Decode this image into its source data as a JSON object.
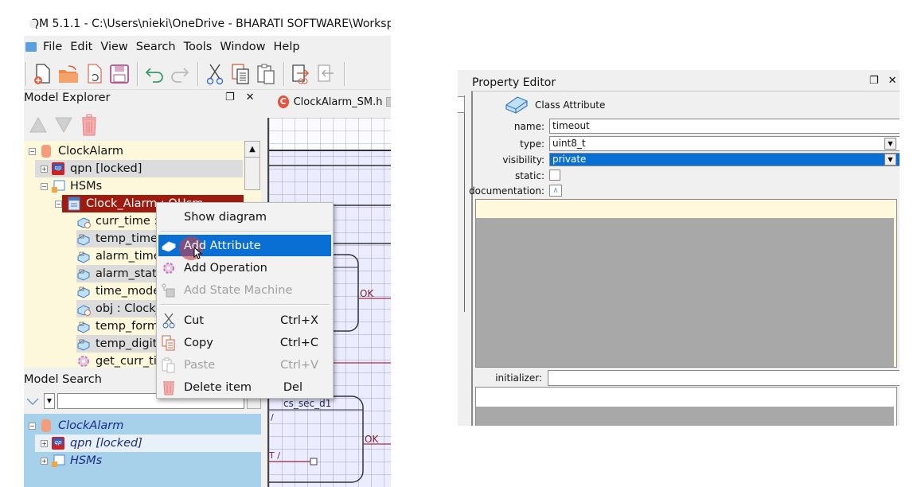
{
  "window": {
    "title": "QM 5.1.1 - C:\\Users\\nieki\\OneDrive - BHARATI SOFTWARE\\Worksp"
  },
  "menubar": [
    "File",
    "Edit",
    "View",
    "Search",
    "Tools",
    "Window",
    "Help"
  ],
  "toolbar": {
    "buttons": [
      {
        "icon": "new-model-icon"
      },
      {
        "icon": "open-model-icon"
      },
      {
        "icon": "reload-model-icon"
      },
      {
        "icon": "save-model-icon"
      },
      {
        "icon": "undo-icon"
      },
      {
        "icon": "redo-icon"
      },
      {
        "icon": "cut-icon"
      },
      {
        "icon": "copy-icon"
      },
      {
        "icon": "paste-icon"
      },
      {
        "icon": "export-link-icon"
      },
      {
        "icon": "import-link-icon"
      }
    ]
  },
  "model_explorer": {
    "title": "Model Explorer",
    "tree": [
      {
        "label": "ClockAlarm",
        "icon": "package-icon",
        "level": 0,
        "expander": "−"
      },
      {
        "label": "qpn [locked]",
        "icon": "qp-framework-icon",
        "level": 1,
        "expander": "+"
      },
      {
        "label": "HSMs",
        "icon": "folder-icon",
        "level": 1,
        "expander": "−"
      },
      {
        "label": "Clock_Alarm : QHsm",
        "icon": "class-icon",
        "level": 2,
        "expander": "−",
        "selected": true
      },
      {
        "label": "curr_time : ",
        "icon": "static-attribute-icon",
        "level": 3
      },
      {
        "label": "temp_time",
        "icon": "attribute-icon",
        "level": 3
      },
      {
        "label": "alarm_time",
        "icon": "attribute-icon",
        "level": 3
      },
      {
        "label": "alarm_status",
        "icon": "attribute-icon",
        "level": 3
      },
      {
        "label": "time_mode",
        "icon": "attribute-icon",
        "level": 3
      },
      {
        "label": "obj : Clock_",
        "icon": "static-attribute-icon",
        "level": 3
      },
      {
        "label": "temp_format",
        "icon": "attribute-icon",
        "level": 3
      },
      {
        "label": "temp_digit",
        "icon": "attribute-icon",
        "level": 3
      },
      {
        "label": "get_curr_time",
        "icon": "operation-icon",
        "level": 3
      }
    ]
  },
  "model_search": {
    "title": "Model Search",
    "query": "",
    "results": [
      {
        "label": "ClockAlarm",
        "icon": "package-icon",
        "expander": "−"
      },
      {
        "label": "qpn [locked]",
        "icon": "qp-framework-icon",
        "expander": "+"
      },
      {
        "label": "HSMs",
        "icon": "folder-icon",
        "expander": "+"
      }
    ]
  },
  "editor_tab": {
    "label": "ClockAlarm_SM.h"
  },
  "diagram": {
    "labels": [
      "OK",
      "cs_sec_d1",
      "OK",
      "/",
      "T /"
    ]
  },
  "context_menu": {
    "items": [
      {
        "label": "Show diagram",
        "icon": "",
        "shortcut": "",
        "state": "normal"
      },
      {
        "type": "separator"
      },
      {
        "label": "Add Attribute",
        "icon": "attribute-icon",
        "shortcut": "",
        "state": "active"
      },
      {
        "label": "Add Operation",
        "icon": "operation-icon",
        "shortcut": "",
        "state": "normal"
      },
      {
        "label": "Add State Machine",
        "icon": "state-machine-icon",
        "shortcut": "",
        "state": "disabled"
      },
      {
        "type": "separator"
      },
      {
        "label": "Cut",
        "icon": "cut-icon",
        "shortcut": "Ctrl+X",
        "state": "normal"
      },
      {
        "label": "Copy",
        "icon": "copy-icon",
        "shortcut": "Ctrl+C",
        "state": "normal"
      },
      {
        "label": "Paste",
        "icon": "paste-icon",
        "shortcut": "Ctrl+V",
        "state": "disabled"
      },
      {
        "label": "Delete item",
        "icon": "trash-icon",
        "shortcut": "Del",
        "state": "normal"
      }
    ]
  },
  "property_editor": {
    "title": "Property Editor",
    "element_type": "Class Attribute",
    "fields": {
      "name_label": "name:",
      "name_value": "timeout",
      "type_label": "type:",
      "type_value": "uint8_t",
      "visibility_label": "visibility:",
      "visibility_value": "private",
      "static_label": "static:",
      "static_checked": false,
      "documentation_label": "documentation:",
      "initializer_label": "initializer:",
      "initializer_value": ""
    }
  },
  "colors": {
    "selection_blue": "#0a6fd5",
    "tree_selected_red": "#9e1b0f",
    "tree_background": "#fdf8dc",
    "search_background": "#a7d1ea"
  }
}
